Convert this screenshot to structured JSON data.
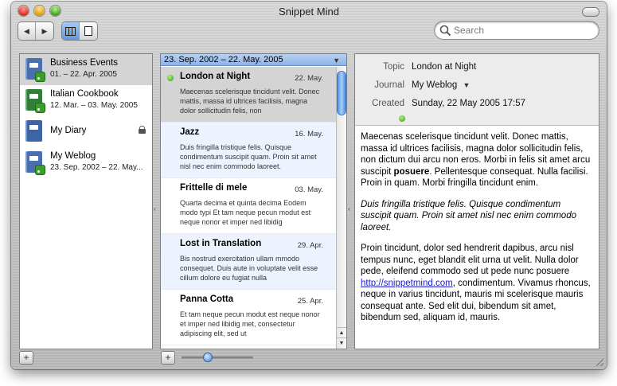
{
  "window": {
    "title": "Snippet Mind"
  },
  "toolbar": {
    "back_label": "◀",
    "forward_label": "▶",
    "search_placeholder": "Search"
  },
  "journals": [
    {
      "name": "Business Events",
      "dates": "01. – 22. Apr. 2005",
      "color": "#4a6fb0",
      "rss": true,
      "locked": false
    },
    {
      "name": "Italian Cookbook",
      "dates": "12. Mar. – 03. May. 2005",
      "color": "#2f7f3a",
      "rss": true,
      "locked": false
    },
    {
      "name": "My Diary",
      "dates": "",
      "color": "#3e64a8",
      "rss": false,
      "locked": true
    },
    {
      "name": "My Weblog",
      "dates": "23. Sep. 2002 – 22. May...",
      "color": "#4a6fb0",
      "rss": true,
      "locked": false
    }
  ],
  "range": {
    "label": "23. Sep. 2002 – 22. May. 2005"
  },
  "entries": [
    {
      "title": "London at Night",
      "date": "22. May.",
      "excerpt": "Maecenas scelerisque tincidunt velit. Donec mattis, massa id ultrices facilisis, magna dolor sollicitudin felis, non"
    },
    {
      "title": "Jazz",
      "date": "16. May.",
      "excerpt": "Duis fringilla tristique felis. Quisque condimentum suscipit quam. Proin sit amet nisl nec enim commodo laoreet."
    },
    {
      "title": "Frittelle di mele",
      "date": "03. May.",
      "excerpt": "Quarta decima et quinta decima Eodem modo typi Et tam neque pecun modut est neque nonor et imper ned libidig"
    },
    {
      "title": "Lost in Translation",
      "date": "29. Apr.",
      "excerpt": "Bis nostrud exercitation ullam mmodo consequet. Duis aute in voluptate velit esse cillum dolore eu fugiat nulla"
    },
    {
      "title": "Panna Cotta",
      "date": "25. Apr.",
      "excerpt": "Et tam neque pecun modut est neque nonor et imper ned libidig met, consectetur adipiscing elit, sed ut"
    }
  ],
  "detail": {
    "topic_label": "Topic",
    "topic": "London at Night",
    "journal_label": "Journal",
    "journal": "My Weblog",
    "created_label": "Created",
    "created": "Sunday, 22 May 2005 17:57",
    "p1_a": "Maecenas scelerisque tincidunt velit. Donec mattis, massa id ultrices facilisis, magna dolor sollicitudin felis, non dictum dui arcu non eros. Morbi in felis sit amet arcu suscipit ",
    "p1_bold": "posuere",
    "p1_b": ". Pellentesque consequat. Nulla facilisi. Proin in quam. Morbi fringilla tincidunt enim.",
    "p2": "Duis fringilla tristique felis. Quisque condimentum suscipit quam. Proin sit amet nisl nec enim commodo laoreet.",
    "p3_a": "Proin tincidunt, dolor sed hendrerit dapibus, arcu nisl tempus nunc, eget blandit elit urna ut velit. Nulla dolor pede, eleifend commodo sed ut pede nunc posuere ",
    "p3_link": "http://snippetmind.com",
    "p3_b": ", condimentum. Vivamus rhoncus, neque in varius tincidunt, mauris mi scelerisque mauris consequat ante. Sed elit dui, bibendum sit amet, bibendum sed, aliquam id, mauris."
  },
  "bottom": {
    "add_label": "+"
  },
  "zoom_slider": {
    "value": 0.35
  }
}
